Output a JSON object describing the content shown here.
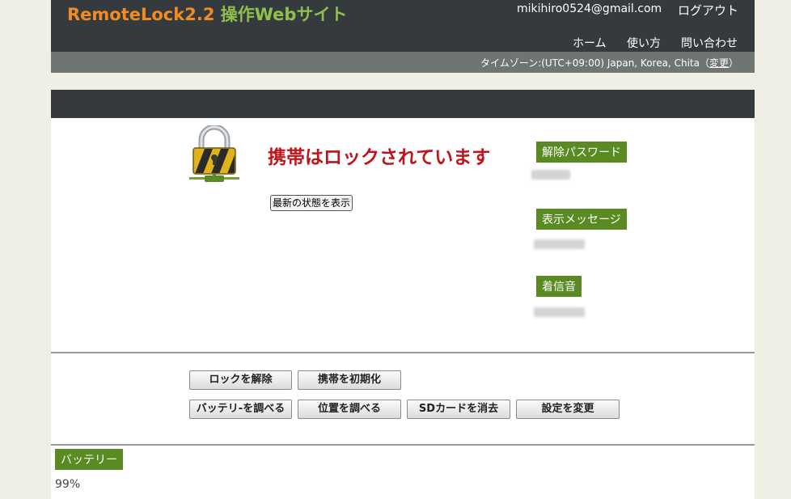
{
  "header": {
    "logo_part1": "RemoteLock2.2",
    "logo_part2": "操作Webサイト",
    "email": "mikihiro0524@gmail.com",
    "logout": "ログアウト",
    "nav": [
      "ホーム",
      "使い方",
      "問い合わせ"
    ]
  },
  "timezone": {
    "label": "タイムゾーン:(UTC+09:00) Japan, Korea, Chita（",
    "change_link": "変更",
    "close_paren": "）"
  },
  "status": {
    "icon": "padlock-icon",
    "message": "携帯はロックされています",
    "refresh_button": "最新の状態を表示"
  },
  "settings": {
    "password_label": "解除パスワード",
    "message_label": "表示メッセージ",
    "ringtone_label": "着信音"
  },
  "actions": {
    "unlock": "ロックを解除",
    "reset": "携帯を初期化",
    "battery": "バッテリ-を調べる",
    "locate": "位置を調べる",
    "sd_erase": "SDカードを消去",
    "change_settings": "設定を変更"
  },
  "battery": {
    "label": "バッテリー",
    "value": "99%"
  },
  "colors": {
    "logo_orange": "#f08c21",
    "logo_green": "#8fc14a",
    "header_dark": "#353a3e",
    "status_red": "#c0141b",
    "tag_green": "#5a8a22"
  }
}
